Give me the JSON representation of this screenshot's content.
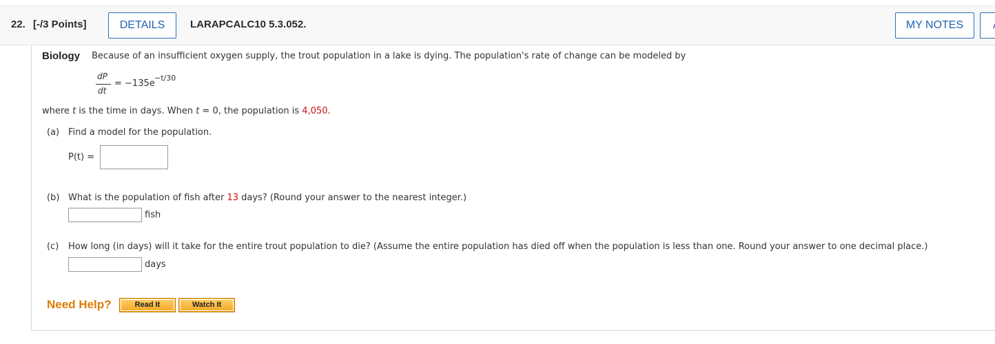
{
  "header": {
    "question_number": "22.",
    "points": "[-/3 Points]",
    "details_label": "DETAILS",
    "problem_id": "LARAPCALC10 5.3.052.",
    "my_notes_label": "MY NOTES",
    "ask_label": "A"
  },
  "problem": {
    "heading": "Biology",
    "intro": "Because of an insufficient oxygen supply, the trout population in a lake is dying. The population's rate of change can be modeled by",
    "equation": {
      "numerator": "dP",
      "denominator": "dt",
      "rhs": "= −135e",
      "exponent": "−t/30"
    },
    "condition": {
      "prefix": "where ",
      "var1": "t",
      "middle": " is the time in days. When ",
      "var2": "t",
      "eq": " = 0, the population is ",
      "value": "4,050",
      "end": "."
    }
  },
  "part_a": {
    "label": "(a)",
    "text": "Find a model for the population.",
    "answer_label": "P(t) =",
    "answer_value": ""
  },
  "part_b": {
    "label": "(b)",
    "text_before": "What is the population of fish after ",
    "highlight": "13",
    "text_after": " days? (Round your answer to the nearest integer.)",
    "answer_value": "",
    "unit": "fish"
  },
  "part_c": {
    "label": "(c)",
    "text": "How long (in days) will it take for the entire trout population to die? (Assume the entire population has died off when the population is less than one. Round your answer to one decimal place.)",
    "answer_value": "",
    "unit": "days"
  },
  "help": {
    "label": "Need Help?",
    "read_it": "Read It",
    "watch_it": "Watch It"
  },
  "colors": {
    "accent_blue": "#1f63b5",
    "highlight_red": "#cc1111",
    "help_orange": "#e07b00"
  }
}
